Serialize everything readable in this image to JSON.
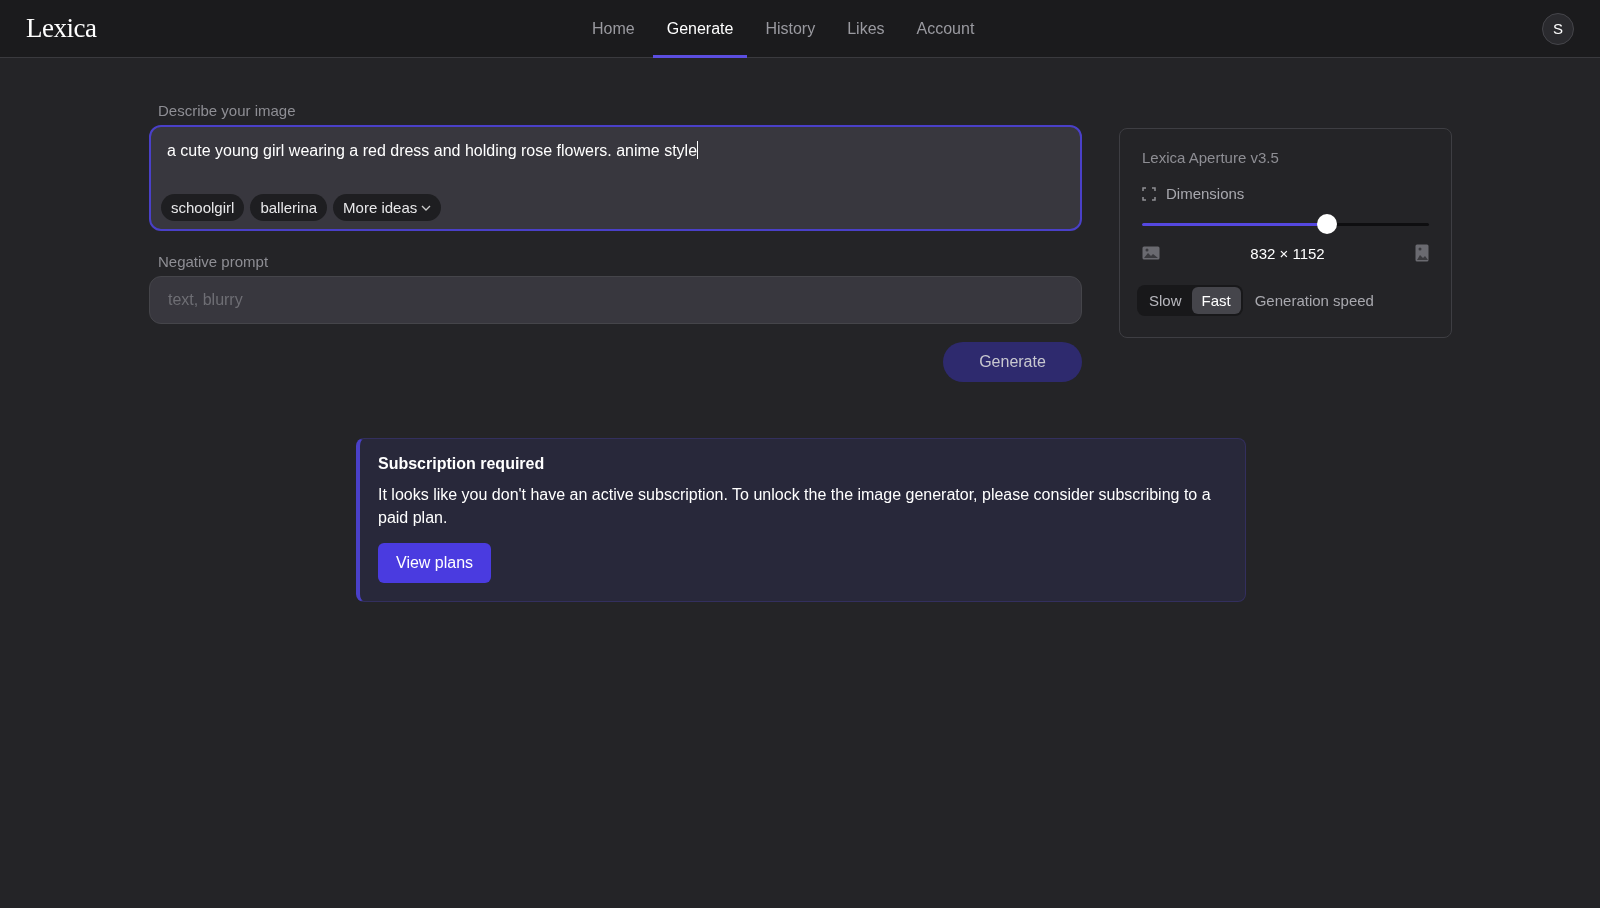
{
  "header": {
    "logo": "Lexica",
    "nav": [
      {
        "label": "Home",
        "selected": false
      },
      {
        "label": "Generate",
        "selected": true
      },
      {
        "label": "History",
        "selected": false
      },
      {
        "label": "Likes",
        "selected": false
      },
      {
        "label": "Account",
        "selected": false
      }
    ],
    "avatar": "S"
  },
  "prompt": {
    "label": "Describe your image",
    "value": "a cute young girl wearing a red dress and holding rose flowers. anime style",
    "suggestions": [
      "schoolgirl",
      "ballerina"
    ],
    "more": "More ideas"
  },
  "negative": {
    "label": "Negative prompt",
    "placeholder": "text, blurry"
  },
  "generate_button": "Generate",
  "settings": {
    "model": "Lexica Aperture v3.5",
    "dimensions_label": "Dimensions",
    "level": 0.655,
    "dimensions": "832 × 1152",
    "speed_options": [
      {
        "label": "Slow",
        "selected": false
      },
      {
        "label": "Fast",
        "selected": true
      }
    ],
    "speed_label": "Generation speed"
  },
  "alert": {
    "title": "Subscription required",
    "message": "It looks like you don't have an active subscription. To unlock the the image generator, please consider subscribing to a paid plan.",
    "button": "View plans"
  }
}
